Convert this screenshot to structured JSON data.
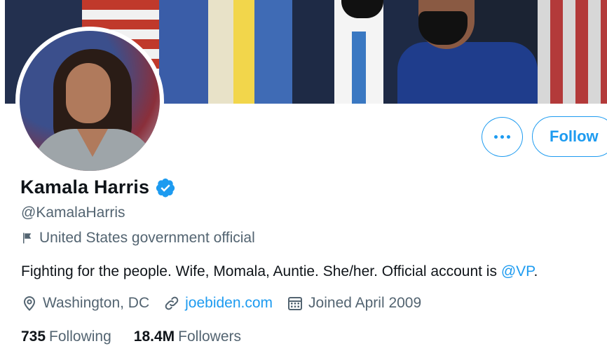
{
  "profile": {
    "name": "Kamala Harris",
    "handle": "@KamalaHarris",
    "category": "United States government official",
    "bio_text": "Fighting for the people. Wife, Momala, Auntie. She/her. Official account is ",
    "bio_link": "@VP",
    "bio_end": ".",
    "location": "Washington, DC",
    "website": "joebiden.com",
    "joined": "Joined April 2009",
    "following_count": "735",
    "following_label": "Following",
    "followers_count": "18.4M",
    "followers_label": "Followers"
  },
  "actions": {
    "follow_label": "Follow"
  },
  "icons": {
    "more": "more-icon",
    "verified": "verified-badge-icon",
    "category": "flag-icon",
    "location": "location-pin-icon",
    "website": "link-icon",
    "joined": "calendar-icon"
  },
  "colors": {
    "accent": "#1d9bf0",
    "text": "#0f1419",
    "secondary": "#536471"
  }
}
